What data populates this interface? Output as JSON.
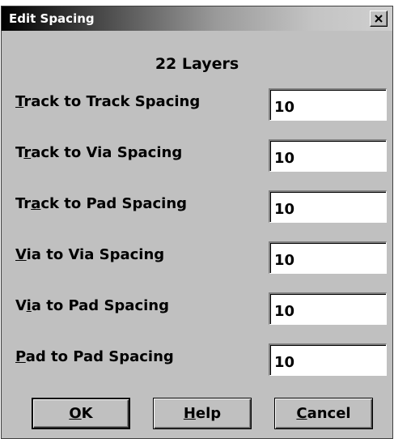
{
  "window": {
    "title": "Edit Spacing",
    "close_glyph": "×"
  },
  "heading": "22 Layers",
  "rows": [
    {
      "label_pre": "",
      "label_key": "T",
      "label_post": "rack to Track Spacing",
      "value": "10"
    },
    {
      "label_pre": "T",
      "label_key": "r",
      "label_post": "ack to Via Spacing",
      "value": "10"
    },
    {
      "label_pre": "Tr",
      "label_key": "a",
      "label_post": "ck to Pad Spacing",
      "value": "10"
    },
    {
      "label_pre": "",
      "label_key": "V",
      "label_post": "ia to Via Spacing",
      "value": "10"
    },
    {
      "label_pre": "V",
      "label_key": "i",
      "label_post": "a to Pad Spacing",
      "value": "10"
    },
    {
      "label_pre": "",
      "label_key": "P",
      "label_post": "ad to Pad Spacing",
      "value": "10"
    }
  ],
  "buttons": {
    "ok": {
      "key": "O",
      "rest": "K"
    },
    "help": {
      "key": "H",
      "rest": "elp"
    },
    "cancel": {
      "key": "C",
      "rest": "ancel"
    }
  },
  "icons": {
    "close": "close-icon"
  }
}
